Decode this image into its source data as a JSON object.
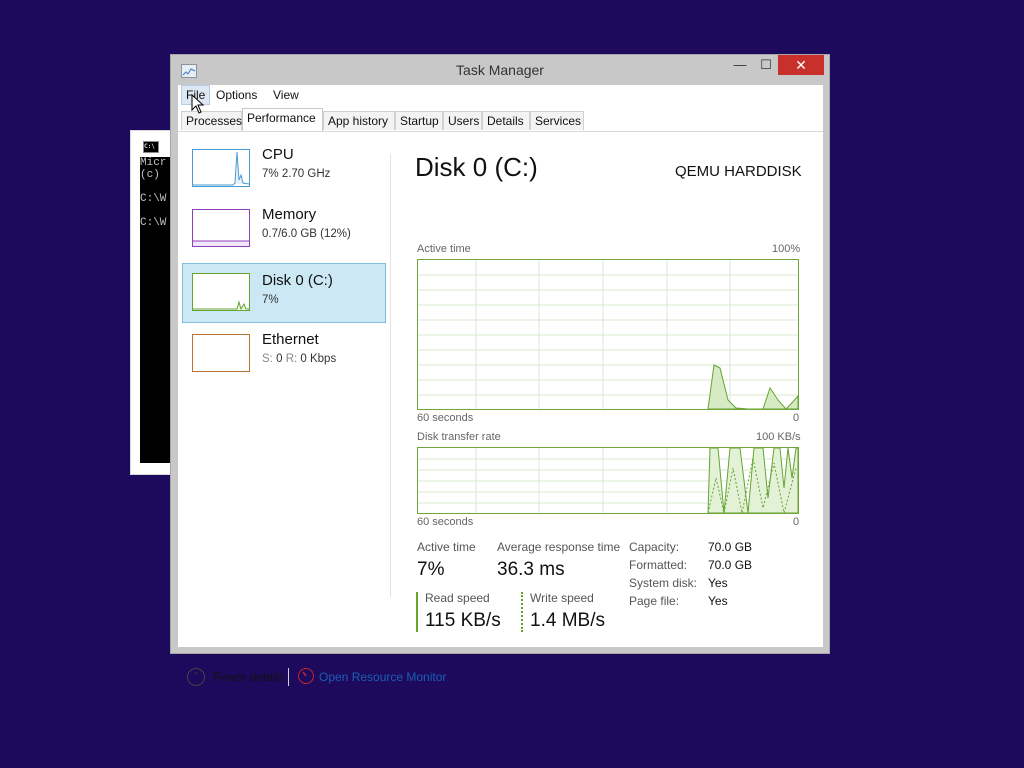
{
  "console": {
    "icon_text": "C:\\",
    "lines": [
      "Micr",
      "(c) ",
      "",
      "C:\\W",
      "",
      "C:\\W"
    ]
  },
  "window": {
    "title": "Task Manager",
    "controls": {
      "minimize": "—",
      "maximize": "☐",
      "close": "✕"
    }
  },
  "menu": [
    "File",
    "Options",
    "View"
  ],
  "tabs": [
    "Processes",
    "Performance",
    "App history",
    "Startup",
    "Users",
    "Details",
    "Services"
  ],
  "active_tab": "Performance",
  "resources": [
    {
      "title": "CPU",
      "sub": "7%  2.70 GHz",
      "color": "#4a9bd1"
    },
    {
      "title": "Memory",
      "sub": "0.7/6.0 GB (12%)",
      "color": "#8e3fb8"
    },
    {
      "title": "Disk 0 (C:)",
      "sub": "7%",
      "color": "#64a530"
    },
    {
      "title": "Ethernet",
      "sub_s": "S:",
      "sub_s_val": "0",
      "sub_r": "R:",
      "sub_r_val": "0 Kbps",
      "color": "#b87333"
    }
  ],
  "detail": {
    "title": "Disk 0 (C:)",
    "model": "QEMU HARDDISK",
    "active_time_graph": {
      "label": "Active time",
      "max": "100%",
      "x_left": "60 seconds",
      "x_right": "0"
    },
    "transfer_graph": {
      "label": "Disk transfer rate",
      "max": "100 KB/s",
      "x_left": "60 seconds",
      "x_right": "0"
    },
    "stats": {
      "active_time_label": "Active time",
      "active_time_value": "7%",
      "response_label": "Average response time",
      "response_value": "36.3 ms",
      "read_label": "Read speed",
      "read_value": "115 KB/s",
      "write_label": "Write speed",
      "write_value": "1.4 MB/s"
    },
    "properties": [
      {
        "label": "Capacity:",
        "value": "70.0 GB"
      },
      {
        "label": "Formatted:",
        "value": "70.0 GB"
      },
      {
        "label": "System disk:",
        "value": "Yes"
      },
      {
        "label": "Page file:",
        "value": "Yes"
      }
    ]
  },
  "footer": {
    "fewer_details": "Fewer details",
    "resource_monitor": "Open Resource Monitor"
  },
  "colors": {
    "desktop": "#1d0a5c",
    "disk_green": "#64a530",
    "close_red": "#c7302b",
    "selection": "#cce8f4"
  }
}
